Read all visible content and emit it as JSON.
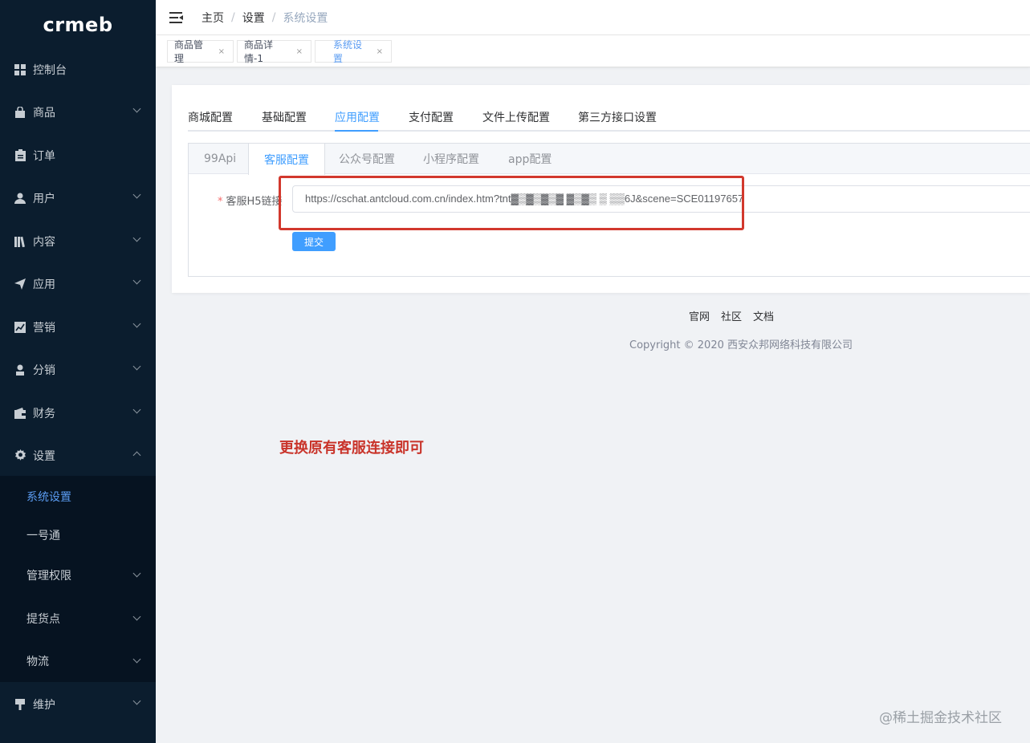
{
  "logo": "crmeb",
  "sidebar": {
    "items": [
      {
        "label": "控制台",
        "icon": "dashboard-icon"
      },
      {
        "label": "商品",
        "icon": "shopping-bag-icon"
      },
      {
        "label": "订单",
        "icon": "clipboard-icon"
      },
      {
        "label": "用户",
        "icon": "user-icon"
      },
      {
        "label": "内容",
        "icon": "library-icon"
      },
      {
        "label": "应用",
        "icon": "paper-plane-icon"
      },
      {
        "label": "营销",
        "icon": "line-chart-icon"
      },
      {
        "label": "分销",
        "icon": "user-stand-icon"
      },
      {
        "label": "财务",
        "icon": "wallet-icon"
      },
      {
        "label": "设置",
        "icon": "gear-icon"
      },
      {
        "label": "维护",
        "icon": "hammer-icon"
      }
    ],
    "sub_items": [
      {
        "label": "系统设置"
      },
      {
        "label": "一号通"
      },
      {
        "label": "管理权限"
      },
      {
        "label": "提货点"
      },
      {
        "label": "物流"
      }
    ]
  },
  "header": {
    "breadcrumb": [
      "主页",
      "设置",
      "系统设置"
    ],
    "separator": "/"
  },
  "page_tabs": [
    {
      "label": "商品管理",
      "close": "×"
    },
    {
      "label": "商品详情-1",
      "close": "×"
    },
    {
      "label": "系统设置",
      "close": "×"
    }
  ],
  "main_tabs": [
    "商城配置",
    "基础配置",
    "应用配置",
    "支付配置",
    "文件上传配置",
    "第三方接口设置"
  ],
  "inner_tabs": [
    "99Api",
    "客服配置",
    "公众号配置",
    "小程序配置",
    "app配置"
  ],
  "form": {
    "required_mark": "*",
    "label": "客服H5链接",
    "value": "https://cschat.antcloud.com.cn/index.htm?tnt▓▒▓▒▓▒▓  ▓▒▓▒ ▒ ▒▒6J&scene=SCE01197657",
    "submit_label": "提交"
  },
  "footer": {
    "links": [
      "官网",
      "社区",
      "文档"
    ],
    "copyright": "Copyright © 2020 西安众邦网络科技有限公司"
  },
  "annotation_note": "更换原有客服连接即可",
  "watermark": "@稀土掘金技术社区",
  "colors": {
    "sidebar_bg": "#0b1d2e",
    "accent": "#409eff",
    "highlight_red": "#d2382d"
  }
}
